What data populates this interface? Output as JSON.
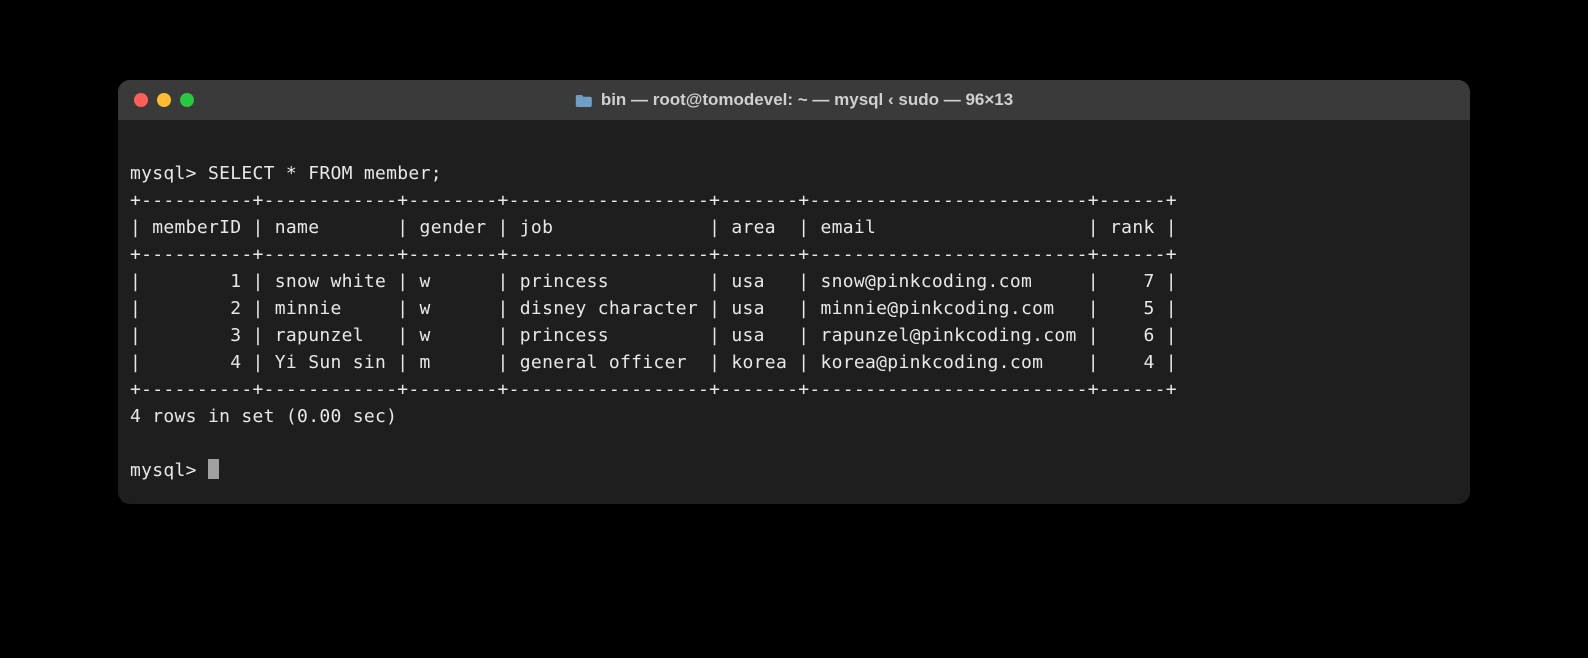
{
  "window": {
    "title": "bin — root@tomodevel: ~ — mysql ‹ sudo — 96×13"
  },
  "terminal": {
    "prompt1": "mysql> ",
    "command": "SELECT * FROM member;",
    "divider": "+----------+------------+--------+------------------+-------+-------------------------+------+",
    "header_row": "| memberID | name       | gender | job              | area  | email                   | rank |",
    "rows": [
      "|        1 | snow white | w      | princess         | usa   | snow@pinkcoding.com     |    7 |",
      "|        2 | minnie     | w      | disney character | usa   | minnie@pinkcoding.com   |    5 |",
      "|        3 | rapunzel   | w      | princess         | usa   | rapunzel@pinkcoding.com |    6 |",
      "|        4 | Yi Sun sin | m      | general officer  | korea | korea@pinkcoding.com    |    4 |"
    ],
    "summary": "4 rows in set (0.00 sec)",
    "prompt2": "mysql> "
  },
  "table_data": {
    "columns": [
      "memberID",
      "name",
      "gender",
      "job",
      "area",
      "email",
      "rank"
    ],
    "rows": [
      {
        "memberID": 1,
        "name": "snow white",
        "gender": "w",
        "job": "princess",
        "area": "usa",
        "email": "snow@pinkcoding.com",
        "rank": 7
      },
      {
        "memberID": 2,
        "name": "minnie",
        "gender": "w",
        "job": "disney character",
        "area": "usa",
        "email": "minnie@pinkcoding.com",
        "rank": 5
      },
      {
        "memberID": 3,
        "name": "rapunzel",
        "gender": "w",
        "job": "princess",
        "area": "usa",
        "email": "rapunzel@pinkcoding.com",
        "rank": 6
      },
      {
        "memberID": 4,
        "name": "Yi Sun sin",
        "gender": "m",
        "job": "general officer",
        "area": "korea",
        "email": "korea@pinkcoding.com",
        "rank": 4
      }
    ]
  }
}
